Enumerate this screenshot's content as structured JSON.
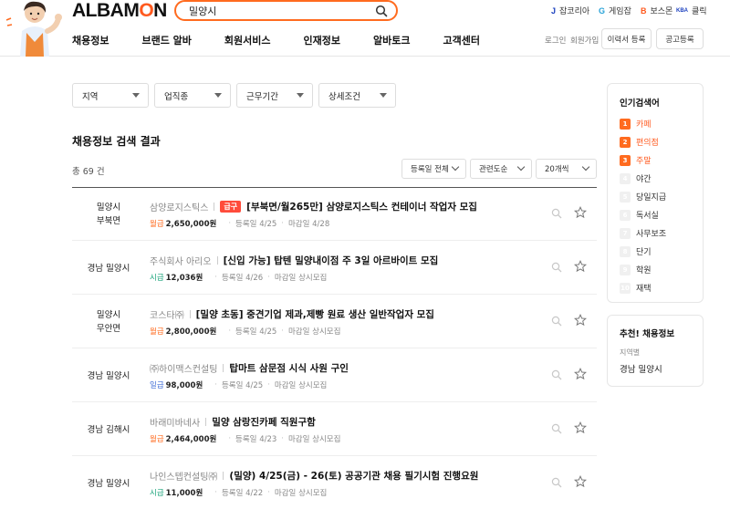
{
  "header": {
    "logo_pre": "ALBAM",
    "logo_o": "O",
    "logo_post": "N",
    "search_value": "밀양시",
    "family_sites": [
      {
        "icon": "J",
        "label": "잡코리아",
        "color": "#1a3fbf"
      },
      {
        "icon": "G",
        "label": "게임잡",
        "color": "#29a3d8"
      },
      {
        "icon": "B",
        "label": "보스몬",
        "color": "#ff5a1f"
      },
      {
        "icon": "KBA",
        "label": "클릭",
        "color": "#1a3fbf"
      }
    ],
    "nav": [
      "채용정보",
      "브랜드 알바",
      "회원서비스",
      "인재정보",
      "알바토크",
      "고객센터"
    ],
    "login": "로그인",
    "signup": "회원가입",
    "resume_btn": "이력서 등록",
    "post_btn": "공고등록"
  },
  "filters": [
    "지역",
    "업직종",
    "근무기간",
    "상세조건"
  ],
  "results": {
    "title": "채용정보 검색 결과",
    "total": "총 69 건",
    "sort_date": "등록일 전체",
    "sort_relevance": "관련도순",
    "per_page": "20개씩"
  },
  "jobs": [
    {
      "loc1": "밀양시",
      "loc2": "부북면",
      "company": "삼양로지스틱스",
      "urgent": "급구",
      "title": "[부북면/월265만] 삼양로지스틱스 컨테이너 작업자 모집",
      "paytype": "월급",
      "pay": "2,650,000원",
      "reg": "등록일 4/25",
      "deadline": "마감일 4/28"
    },
    {
      "loc1": "경남 밀양시",
      "loc2": "",
      "company": "주식회사 아리오",
      "urgent": "",
      "title": "[신입 가능] 탑텐 밀양내이점 주 3일 아르바이트 모집",
      "paytype": "시급",
      "pay": "12,036원",
      "reg": "등록일 4/26",
      "deadline": "마감일 상시모집"
    },
    {
      "loc1": "밀양시",
      "loc2": "무안면",
      "company": "코스타㈜",
      "urgent": "",
      "title": "[밀양 초동] 중견기업 제과,제빵 원료 생산 일반작업자 모집",
      "paytype": "월급",
      "pay": "2,800,000원",
      "reg": "등록일 4/25",
      "deadline": "마감일 상시모집"
    },
    {
      "loc1": "경남 밀양시",
      "loc2": "",
      "company": "㈜하이맥스컨설팅",
      "urgent": "",
      "title": "탑마트 삼문점 시식 사원 구인",
      "paytype": "일급",
      "pay": "98,000원",
      "reg": "등록일 4/25",
      "deadline": "마감일 상시모집"
    },
    {
      "loc1": "경남 김해시",
      "loc2": "",
      "company": "바래미바네사",
      "urgent": "",
      "title": "밀양 삼랑진카페 직원구함",
      "paytype": "월급",
      "pay": "2,464,000원",
      "reg": "등록일 4/23",
      "deadline": "마감일 상시모집"
    },
    {
      "loc1": "경남 밀양시",
      "loc2": "",
      "company": "나인스텝컨설팅㈜",
      "urgent": "",
      "title": "(밀양) 4/25(금) - 26(토) 공공기관 채용 필기시험 진행요원",
      "paytype": "시급",
      "pay": "11,000원",
      "reg": "등록일 4/22",
      "deadline": "마감일 상시모집"
    }
  ],
  "sidebar": {
    "popular_title": "인기검색어",
    "popular": [
      "카페",
      "편의점",
      "주말",
      "야간",
      "당일지급",
      "독서실",
      "사무보조",
      "단기",
      "학원",
      "재택"
    ],
    "rec_title": "추천! 채용정보",
    "rec_label": "지역별",
    "rec_value": "경남 밀양시"
  },
  "colors": {
    "accent": "#ff6b1f",
    "monthly": "#ff6b1f",
    "hourly": "#1aa37a",
    "daily": "#3d6bd6"
  }
}
